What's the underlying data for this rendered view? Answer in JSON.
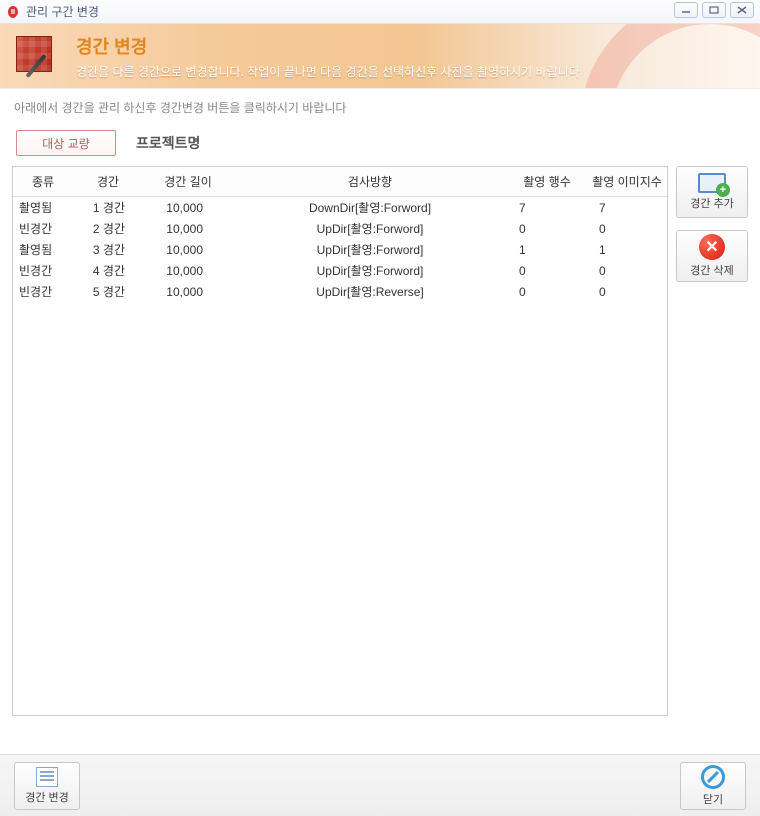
{
  "window": {
    "title": "관리 구간 변경"
  },
  "header": {
    "title": "경간 변경",
    "subtitle": "경간을 다른 경간으로 변경합니다. 작업이 끝나면 다음 경간을 선택하신후 사진을 촬영하시기 바랍니다"
  },
  "instruction": "아래에서 경간을 관리 하신후 경간변경 버튼을 클릭하시기 바랍니다",
  "top": {
    "target_button": "대상 교량",
    "project_label": "프로젝트명"
  },
  "table": {
    "headers": {
      "type": "종류",
      "span": "경간",
      "length": "경간 길이",
      "direction": "검사방향",
      "rows": "촬영 행수",
      "images": "촬영 이미지수"
    },
    "rows": [
      {
        "type": "촬영됨",
        "span": "1 경간",
        "length": "10,000",
        "direction": "DownDir[촬영:Forword]",
        "rows": "7",
        "images": "7"
      },
      {
        "type": "빈경간",
        "span": "2 경간",
        "length": "10,000",
        "direction": "UpDir[촬영:Forword]",
        "rows": "0",
        "images": "0"
      },
      {
        "type": "촬영됨",
        "span": "3 경간",
        "length": "10,000",
        "direction": "UpDir[촬영:Forword]",
        "rows": "1",
        "images": "1"
      },
      {
        "type": "빈경간",
        "span": "4 경간",
        "length": "10,000",
        "direction": "UpDir[촬영:Forword]",
        "rows": "0",
        "images": "0"
      },
      {
        "type": "빈경간",
        "span": "5 경간",
        "length": "10,000",
        "direction": "UpDir[촬영:Reverse]",
        "rows": "0",
        "images": "0"
      }
    ]
  },
  "side": {
    "add": "경간 추가",
    "delete": "경간 삭제"
  },
  "footer": {
    "change": "경간 변경",
    "close": "닫기"
  }
}
